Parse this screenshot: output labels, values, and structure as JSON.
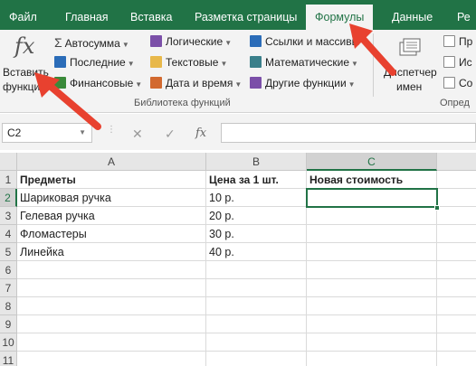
{
  "tabs": [
    {
      "label": "Файл"
    },
    {
      "label": "Главная"
    },
    {
      "label": "Вставка"
    },
    {
      "label": "Разметка страницы"
    },
    {
      "label": "Формулы"
    },
    {
      "label": "Данные"
    },
    {
      "label": "Ре"
    }
  ],
  "ribbon": {
    "insert_function": {
      "line1": "Вставить",
      "line2": "функци"
    },
    "library": {
      "autosum": "Автосумма",
      "recent": "Последние",
      "financial": "Финансовые",
      "logical": "Логические",
      "text": "Текстовые",
      "datetime": "Дата и время",
      "lookup": "Ссылки и массивы",
      "math": "Математические",
      "more": "Другие функции",
      "group_label": "Библиотека функций"
    },
    "name_manager": {
      "line1": "Диспетчер",
      "line2": "имен"
    },
    "defined_names": {
      "item1": "Пр",
      "item2": "Ис",
      "item3": "Со",
      "group_label": "Опред"
    }
  },
  "formula_bar": {
    "name_box": "C2",
    "cancel": "✕",
    "enter": "✓",
    "fx": "fx",
    "value": ""
  },
  "sheet": {
    "columns": [
      "A",
      "B",
      "C"
    ],
    "rows": [
      "1",
      "2",
      "3",
      "4",
      "5",
      "6",
      "7",
      "8",
      "9",
      "10",
      "11"
    ],
    "header_row": [
      "Предметы",
      "Цена за 1 шт.",
      "Новая стоимость"
    ],
    "data": [
      [
        "Шариковая ручка",
        "10 р.",
        ""
      ],
      [
        "Гелевая ручка",
        "20 р.",
        ""
      ],
      [
        "Фломастеры",
        "30 р.",
        ""
      ],
      [
        "Линейка",
        "40 р.",
        ""
      ]
    ],
    "active_cell": "C2"
  },
  "colors": {
    "accent": "#217346",
    "arrow": "#e8412f"
  }
}
